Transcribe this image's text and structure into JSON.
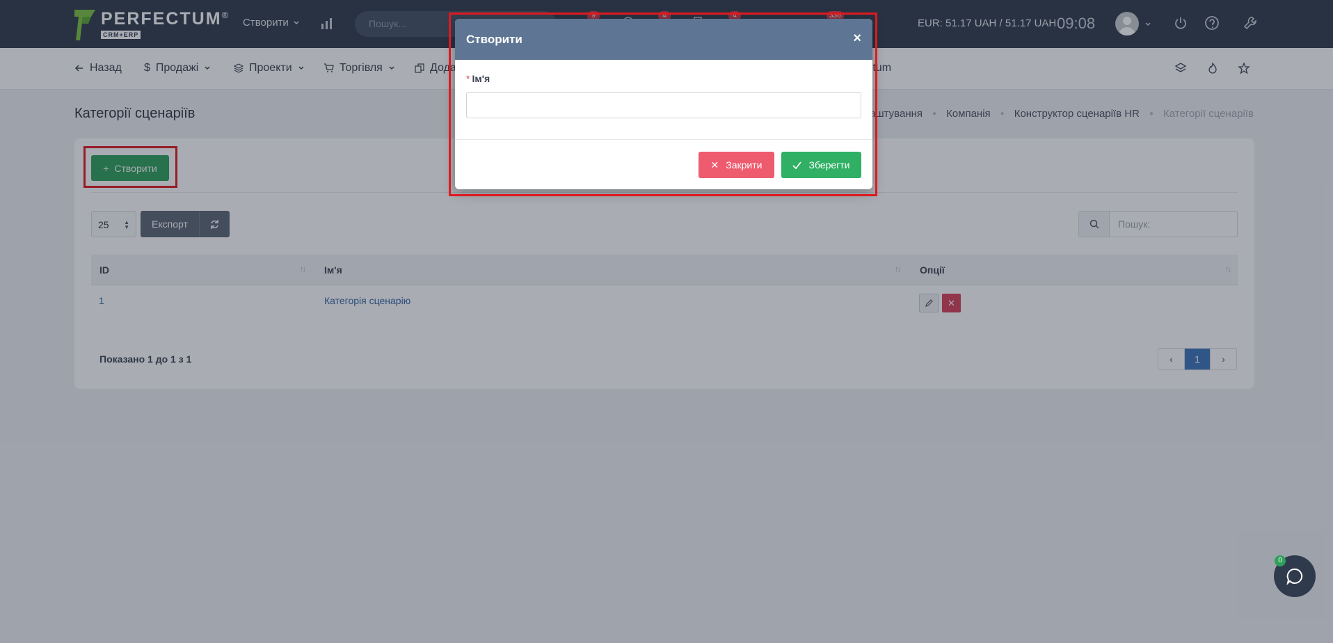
{
  "header": {
    "logo_name": "PERFECTUM",
    "logo_reg": "®",
    "logo_sub": "CRM+ERP",
    "create_label": "Створити",
    "search_placeholder": "Пошук...",
    "badges": [
      "9",
      "4",
      "4",
      "336"
    ],
    "currency": "EUR: 51.17 UAH / 51.17 UAH",
    "time": "09:08"
  },
  "nav": {
    "back": "Назад",
    "sales": "Продажі",
    "projects": "Проекти",
    "trade": "Торгівля",
    "addons": "Дода",
    "perfectum": "fectum"
  },
  "page": {
    "title": "Категорії сценаріїв",
    "breadcrumb": [
      "Налаштування",
      "Компанія",
      "Конструктор сценаріїв HR",
      "Категорії сценаріїв"
    ],
    "create_button": "Створити",
    "page_length": "25",
    "export_button": "Експорт",
    "search_placeholder": "Пошук:",
    "columns": [
      "ID",
      "Ім'я",
      "Опції"
    ],
    "rows": [
      {
        "id": "1",
        "name": "Категорія сценарію"
      }
    ],
    "info": "Показано 1 до 1 з 1",
    "current_page": "1"
  },
  "chat": {
    "count": "0"
  },
  "modal": {
    "title": "Створити",
    "close_x": "×",
    "required_mark": "*",
    "field_label": "Ім'я",
    "field_value": "",
    "close_button": "Закрити",
    "save_button": "Зберегти"
  },
  "colors": {
    "header_bg": "#2f3b4c",
    "modal_header": "#5e7693",
    "success": "#2fb064",
    "danger": "#ee5b6e",
    "highlight": "#e0191f"
  }
}
